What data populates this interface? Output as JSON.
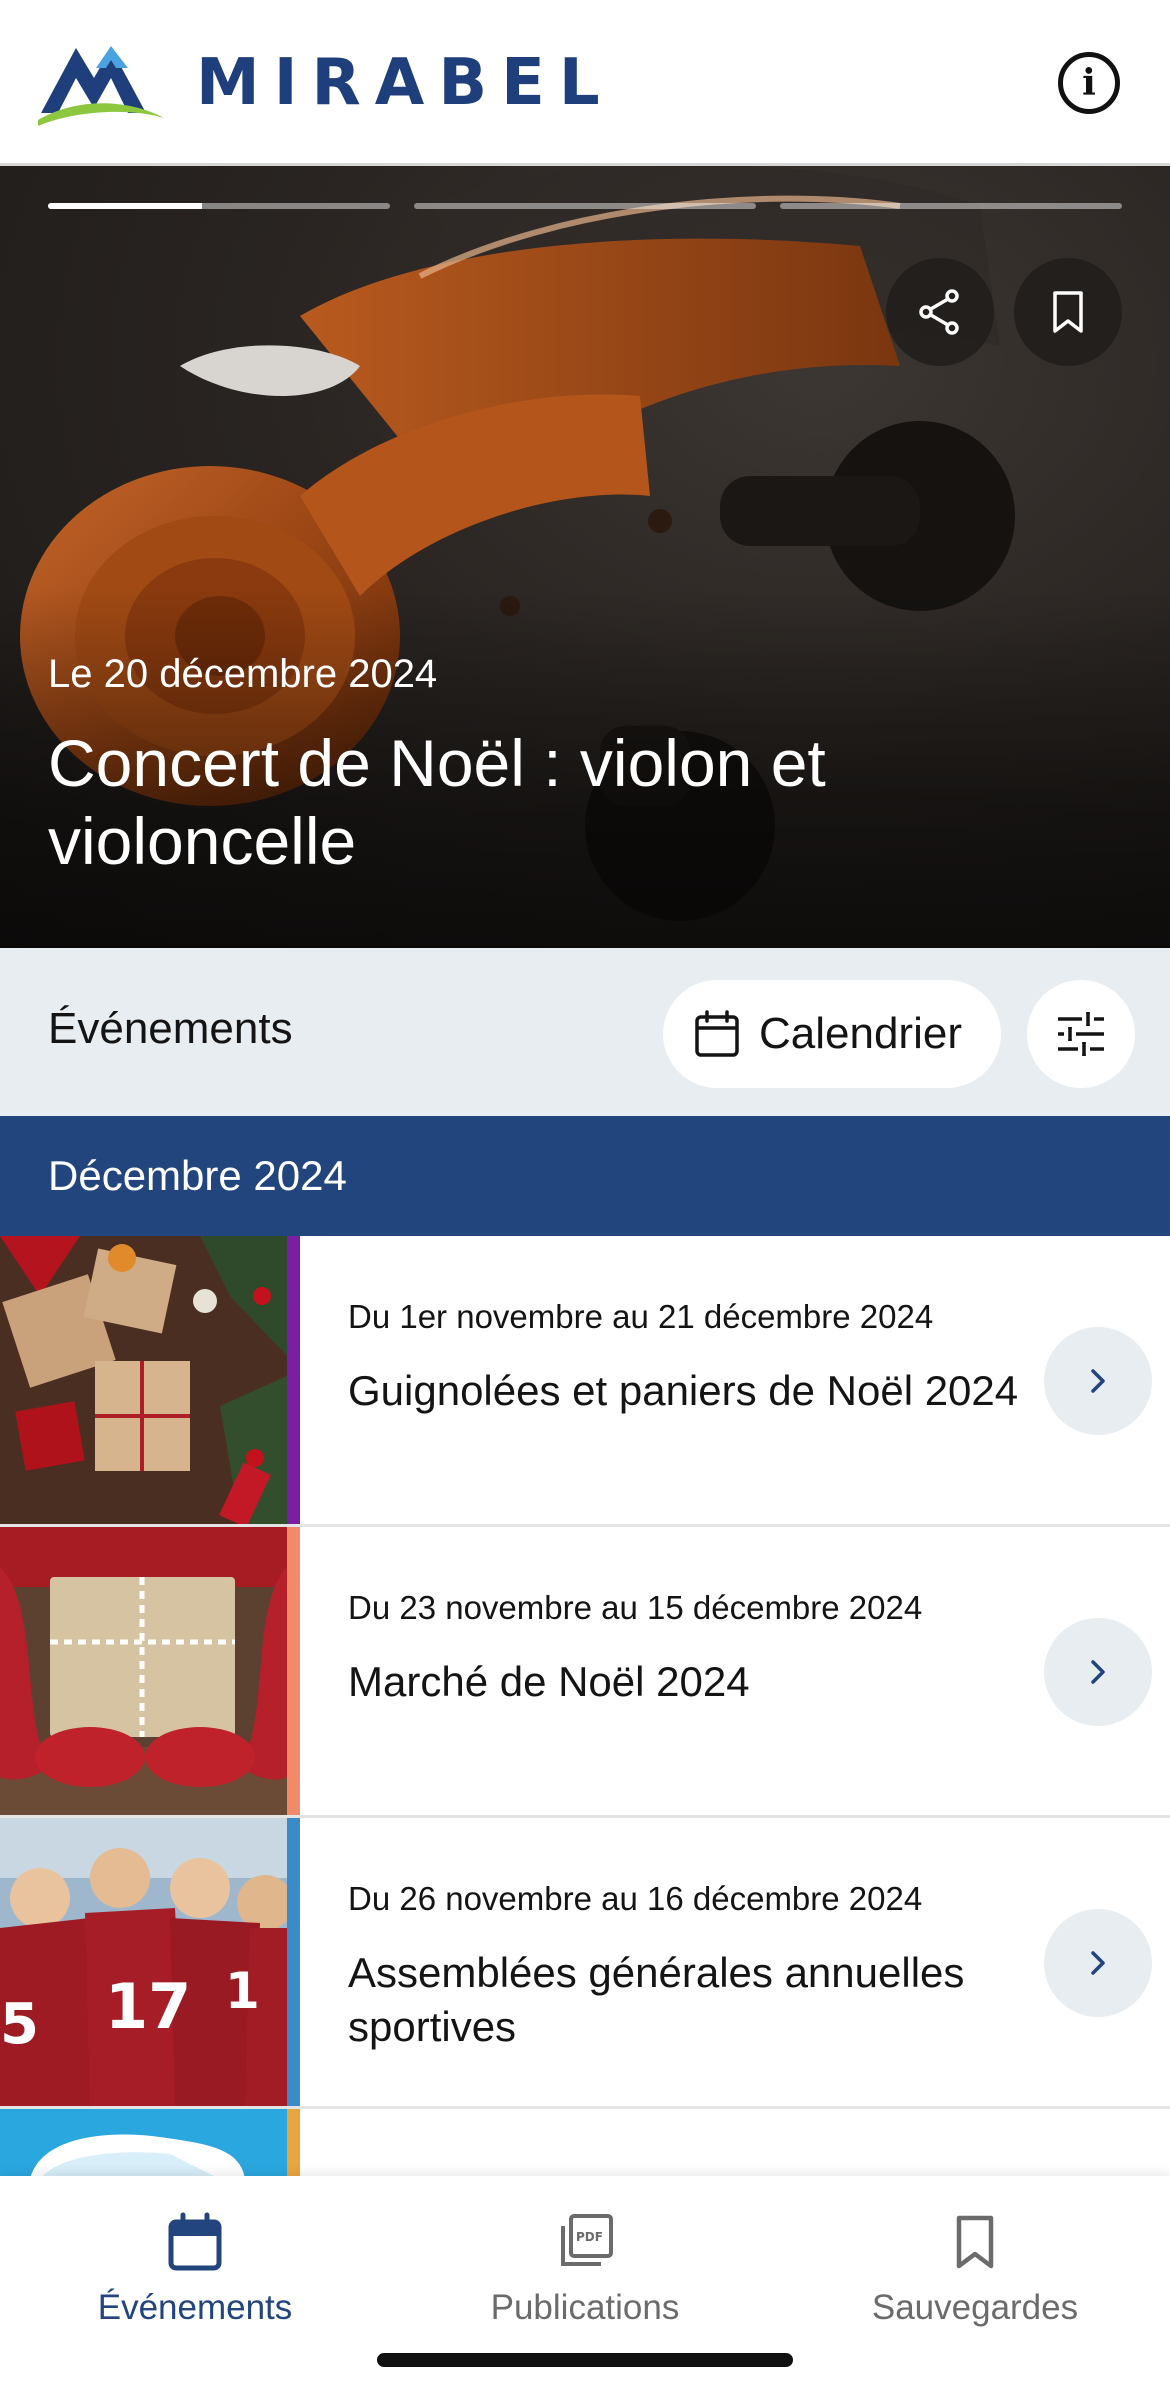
{
  "header": {
    "logo_text": "MIRABEL",
    "logo_icon": "mirabel-logo",
    "info_icon": "info-icon"
  },
  "hero": {
    "date": "Le 20 décembre 2024",
    "title": "Concert de Noël : violon et violoncelle",
    "slides_total": 3,
    "active_slide": 1,
    "active_slide_progress": 0.45,
    "share_icon": "share-icon",
    "bookmark_icon": "bookmark-icon"
  },
  "toolbar": {
    "title": "Événements",
    "calendar_label": "Calendrier",
    "calendar_icon": "calendar-icon",
    "filter_icon": "sliders-icon"
  },
  "month": {
    "label": "Décembre 2024"
  },
  "events": [
    {
      "date": "Du 1er novembre au 21 décembre 2024",
      "title": "Guignolées et paniers de Noël 2024",
      "accent": "#7b1fa2"
    },
    {
      "date": "Du 23 novembre au 15 décembre 2024",
      "title": "Marché de Noël 2024",
      "accent": "#f08a6a"
    },
    {
      "date": "Du 26 novembre au 16 décembre 2024",
      "title": "Assemblées générales annuelles sportives",
      "accent": "#3b8bc9"
    }
  ],
  "partial_event": {
    "accent": "#e8a640"
  },
  "tabs": [
    {
      "label": "Événements",
      "icon": "calendar-icon",
      "active": true
    },
    {
      "label": "Publications",
      "icon": "pdf-icon",
      "active": false
    },
    {
      "label": "Sauvegardes",
      "icon": "bookmark-icon",
      "active": false
    }
  ],
  "colors": {
    "brand_blue": "#22457e",
    "toolbar_bg": "#e8edf1"
  }
}
